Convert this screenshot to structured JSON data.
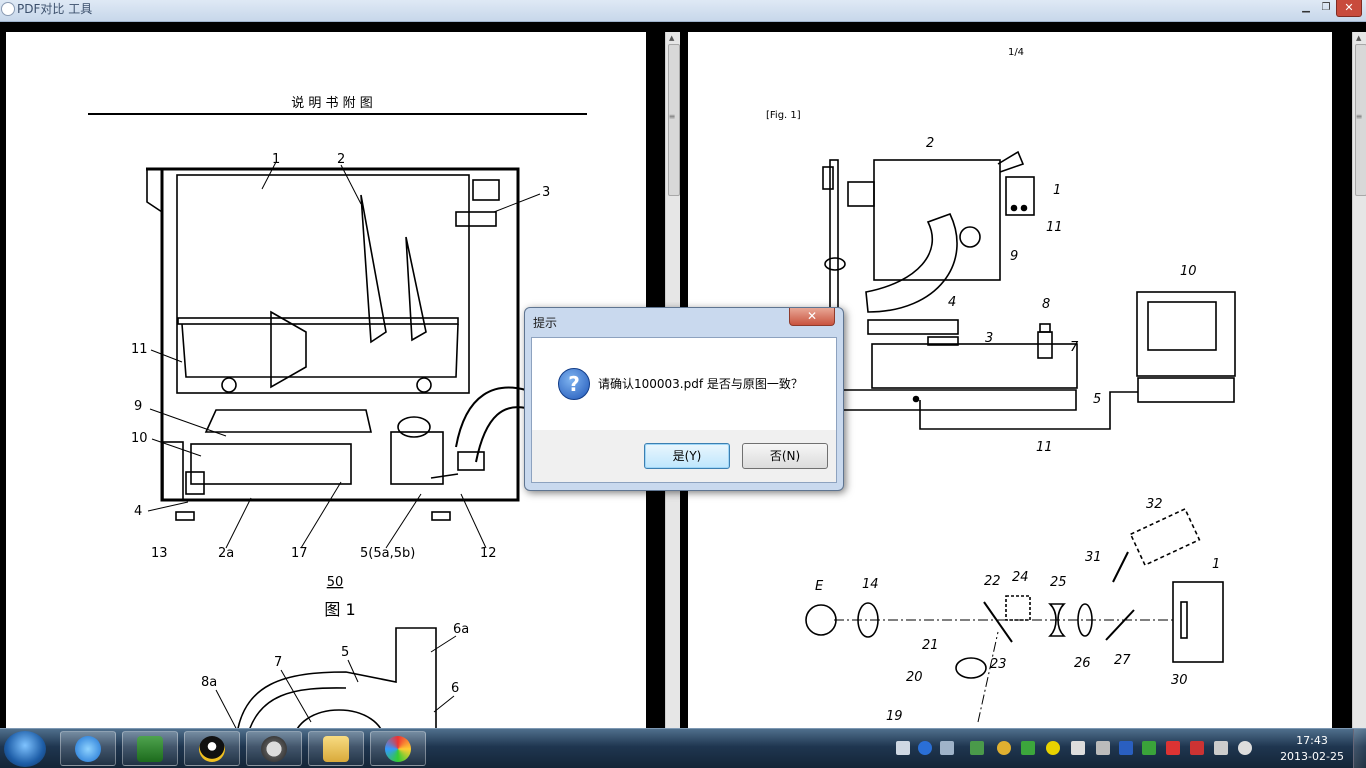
{
  "window": {
    "title": "PDF对比 工具",
    "minimize": "▁",
    "restore": "❐",
    "close": "✕"
  },
  "left_page": {
    "heading": "说 明 书 附 图",
    "fig_number": "50",
    "fig_caption": "图 1",
    "labels": [
      "1",
      "2",
      "3",
      "11",
      "9",
      "10",
      "4",
      "13",
      "2a",
      "17",
      "5(5a,5b)",
      "12",
      "6a",
      "5",
      "7",
      "8a",
      "6"
    ]
  },
  "right_page": {
    "page_number": "1/4",
    "fig_label": "[Fig. 1]",
    "labels": [
      "2",
      "1",
      "11",
      "9",
      "10",
      "4",
      "8",
      "7",
      "3",
      "5",
      "11",
      "32",
      "31",
      "E",
      "14",
      "22",
      "24",
      "25",
      "1",
      "21",
      "23",
      "26",
      "27",
      "30",
      "20",
      "19"
    ]
  },
  "dialog": {
    "title": "提示",
    "close": "✕",
    "icon": "?",
    "message": "请确认100003.pdf 是否与原图一致？",
    "yes_label": "是(Y)",
    "no_label": "否(N)"
  },
  "taskbar": {
    "apps": [
      "internet-explorer",
      "excel",
      "qq",
      "vmware",
      "file-explorer",
      "paint"
    ],
    "time": "17:43",
    "date": "2013-02-25"
  }
}
